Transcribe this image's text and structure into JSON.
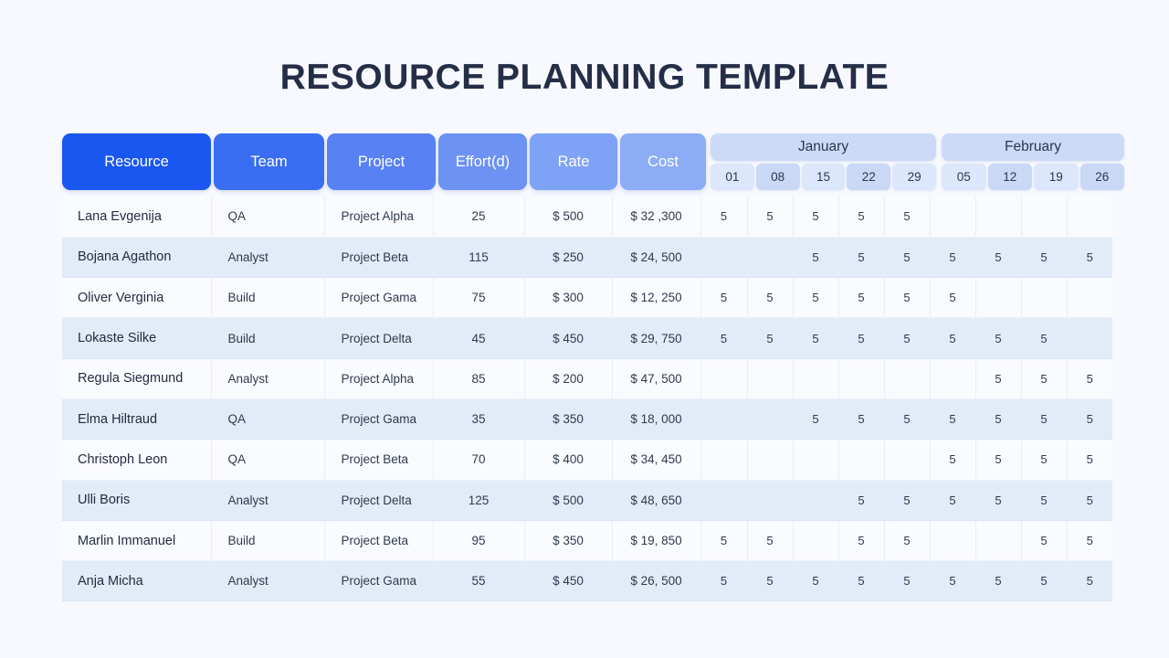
{
  "page": {
    "title": "RESOURCE PLANNING TEMPLATE",
    "background_color": "#f8f9ff",
    "title_color": "#252e47"
  },
  "colors": {
    "header_resource": "#1a56f0",
    "header_team": "#3a6ef2",
    "header_project": "#5881f3",
    "header_effort": "#6c92f4",
    "header_rate": "#7ea2f5",
    "header_cost": "#8cadf6",
    "month_band": "#ccdaf7",
    "week_odd": "#dde7fb",
    "week_even": "#c9d8f5",
    "row_odd": "#fafbfe",
    "row_even": "#e2ebf8",
    "text_dark": "#2f3950"
  },
  "table": {
    "columns": [
      {
        "key": "resource",
        "label": "Resource"
      },
      {
        "key": "team",
        "label": "Team"
      },
      {
        "key": "project",
        "label": "Project"
      },
      {
        "key": "effort",
        "label": "Effort(d)"
      },
      {
        "key": "rate",
        "label": "Rate"
      },
      {
        "key": "cost",
        "label": "Cost"
      }
    ],
    "months": [
      {
        "label": "January",
        "weeks": [
          "01",
          "08",
          "15",
          "22",
          "29"
        ]
      },
      {
        "label": "February",
        "weeks": [
          "05",
          "12",
          "19",
          "26"
        ]
      }
    ],
    "allocation_value": "5",
    "rows": [
      {
        "resource": "Lana Evgenija",
        "team": "QA",
        "project": "Project Alpha",
        "effort": "25",
        "rate": "$ 500",
        "cost": "$ 32 ,300",
        "weeks": [
          "5",
          "5",
          "5",
          "5",
          "5",
          "",
          "",
          "",
          ""
        ]
      },
      {
        "resource": "Bojana Agathon",
        "team": "Analyst",
        "project": "Project Beta",
        "effort": "115",
        "rate": "$ 250",
        "cost": "$ 24, 500",
        "weeks": [
          "",
          "",
          "5",
          "5",
          "5",
          "5",
          "5",
          "5",
          "5"
        ]
      },
      {
        "resource": "Oliver Verginia",
        "team": "Build",
        "project": "Project Gama",
        "effort": "75",
        "rate": "$ 300",
        "cost": "$ 12, 250",
        "weeks": [
          "5",
          "5",
          "5",
          "5",
          "5",
          "5",
          "",
          "",
          ""
        ]
      },
      {
        "resource": "Lokaste Silke",
        "team": "Build",
        "project": "Project Delta",
        "effort": "45",
        "rate": "$ 450",
        "cost": "$ 29, 750",
        "weeks": [
          "5",
          "5",
          "5",
          "5",
          "5",
          "5",
          "5",
          "5",
          ""
        ]
      },
      {
        "resource": "Regula Siegmund",
        "team": "Analyst",
        "project": "Project Alpha",
        "effort": "85",
        "rate": "$ 200",
        "cost": "$ 47, 500",
        "weeks": [
          "",
          "",
          "",
          "",
          "",
          "",
          "5",
          "5",
          "5"
        ]
      },
      {
        "resource": "Elma Hiltraud",
        "team": "QA",
        "project": "Project Gama",
        "effort": "35",
        "rate": "$ 350",
        "cost": "$ 18, 000",
        "weeks": [
          "",
          "",
          "5",
          "5",
          "5",
          "5",
          "5",
          "5",
          "5"
        ]
      },
      {
        "resource": "Christoph Leon",
        "team": "QA",
        "project": "Project Beta",
        "effort": "70",
        "rate": "$ 400",
        "cost": "$ 34, 450",
        "weeks": [
          "",
          "",
          "",
          "",
          "",
          "5",
          "5",
          "5",
          "5"
        ]
      },
      {
        "resource": "Ulli Boris",
        "team": "Analyst",
        "project": "Project Delta",
        "effort": "125",
        "rate": "$ 500",
        "cost": "$ 48, 650",
        "weeks": [
          "",
          "",
          "",
          "5",
          "5",
          "5",
          "5",
          "5",
          "5"
        ]
      },
      {
        "resource": "Marlin Immanuel",
        "team": "Build",
        "project": "Project Beta",
        "effort": "95",
        "rate": "$ 350",
        "cost": "$ 19, 850",
        "weeks": [
          "5",
          "5",
          "",
          "5",
          "5",
          "",
          "",
          "5",
          "5"
        ]
      },
      {
        "resource": "Anja Micha",
        "team": "Analyst",
        "project": "Project Gama",
        "effort": "55",
        "rate": "$ 450",
        "cost": "$ 26, 500",
        "weeks": [
          "5",
          "5",
          "5",
          "5",
          "5",
          "5",
          "5",
          "5",
          "5"
        ]
      }
    ]
  }
}
